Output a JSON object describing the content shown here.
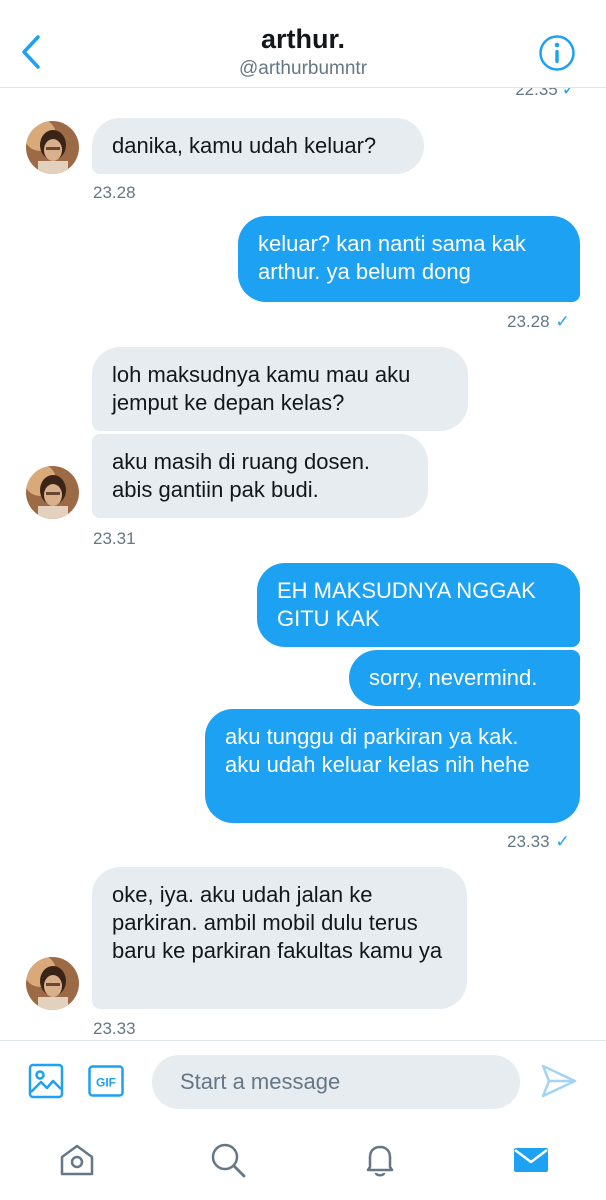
{
  "header": {
    "name": "arthur.",
    "handle": "@arthurbumntr"
  },
  "clipped_timestamp": "22.35",
  "messages": {
    "m1": "danika, kamu udah keluar?",
    "t1": "23.28",
    "m2": "keluar? kan nanti sama kak arthur. ya belum dong",
    "t2": "23.28",
    "m3": "loh maksudnya kamu mau aku jemput ke depan kelas?",
    "m4": "aku masih di ruang dosen. abis gantiin pak budi.",
    "t3": "23.31",
    "m5": "EH MAKSUDNYA NGGAK GITU KAK",
    "m6": "sorry, nevermind.",
    "m7": "aku tunggu di parkiran ya kak. aku udah keluar kelas nih hehe",
    "t4": "23.33",
    "m8": "oke, iya. aku udah jalan ke parkiran. ambil mobil dulu terus baru ke parkiran fakultas kamu ya",
    "t5": "23.33"
  },
  "composer": {
    "placeholder": "Start a message",
    "gif_label": "GIF"
  },
  "icons": {
    "back": "chevron-left-icon",
    "info": "info-icon",
    "media": "image-icon",
    "gif": "gif-icon",
    "send": "send-icon",
    "home": "home-icon",
    "search": "search-icon",
    "notifications": "bell-icon",
    "messages": "mail-icon"
  },
  "colors": {
    "accent": "#1da1f2",
    "received_bubble": "#e6ecf0",
    "secondary_text": "#657786"
  }
}
